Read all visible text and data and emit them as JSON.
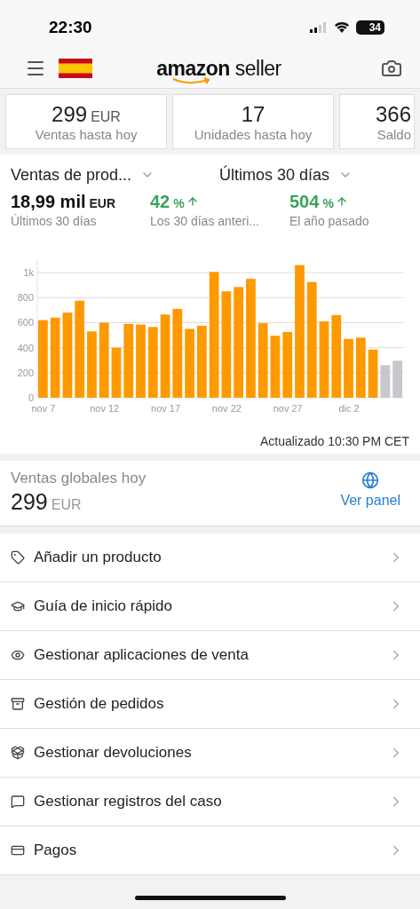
{
  "status_bar": {
    "time": "22:30",
    "battery": "34"
  },
  "header": {
    "logo_bold": "amazon",
    "logo_light": "seller"
  },
  "summary_cards": [
    {
      "value": "299",
      "unit": "EUR",
      "label": "Ventas hasta hoy"
    },
    {
      "value": "17",
      "label": "Unidades hasta hoy"
    },
    {
      "value": "366",
      "label": "Saldo"
    }
  ],
  "filters": [
    {
      "label": "Ventas de prod..."
    },
    {
      "label": "Últimos 30 días"
    }
  ],
  "metrics": [
    {
      "value": "18,99 mil",
      "unit": "EUR",
      "caption": "Últimos 30 días",
      "arrow_up": false
    },
    {
      "value": "42",
      "unit": "%",
      "caption": "Los 30 días anteri...",
      "arrow_up": true
    },
    {
      "value": "504",
      "unit": "%",
      "caption": "El año pasado",
      "arrow_up": true
    }
  ],
  "chart_data": {
    "type": "bar",
    "categories": [
      "nov 7",
      null,
      null,
      null,
      null,
      "nov 12",
      null,
      null,
      null,
      null,
      "nov 17",
      null,
      null,
      null,
      null,
      "nov 22",
      null,
      null,
      null,
      null,
      "nov 27",
      null,
      null,
      null,
      null,
      "dic 2",
      null,
      null,
      null,
      null
    ],
    "grid": true,
    "ylim": [
      0,
      1100
    ],
    "yticks": [
      0,
      200,
      400,
      600,
      800,
      {
        "value": 1000,
        "label": "1k"
      }
    ],
    "series": [
      {
        "color": "#ff9900",
        "values": [
          620,
          640,
          680,
          775,
          530,
          600,
          400,
          590,
          585,
          565,
          665,
          710,
          550,
          575,
          1005,
          850,
          885,
          950,
          595,
          495,
          525,
          1060,
          925,
          610,
          660,
          470,
          480,
          385,
          null,
          null
        ]
      },
      {
        "color": "#c7c7cc",
        "values": [
          null,
          null,
          null,
          null,
          null,
          null,
          null,
          null,
          null,
          null,
          null,
          null,
          null,
          null,
          null,
          null,
          null,
          null,
          null,
          null,
          null,
          null,
          null,
          null,
          null,
          null,
          null,
          null,
          260,
          295
        ]
      }
    ]
  },
  "updated": "Actualizado 10:30 PM CET",
  "global_sales": {
    "title": "Ventas globales hoy",
    "value": "299",
    "unit": "EUR",
    "link": "Ver panel"
  },
  "menu": [
    {
      "label": "Añadir un producto"
    },
    {
      "label": "Guía de inicio rápido"
    },
    {
      "label": "Gestionar aplicaciones de venta"
    },
    {
      "label": "Gestión de pedidos"
    },
    {
      "label": "Gestionar devoluciones"
    },
    {
      "label": "Gestionar registros del caso"
    },
    {
      "label": "Pagos"
    }
  ]
}
